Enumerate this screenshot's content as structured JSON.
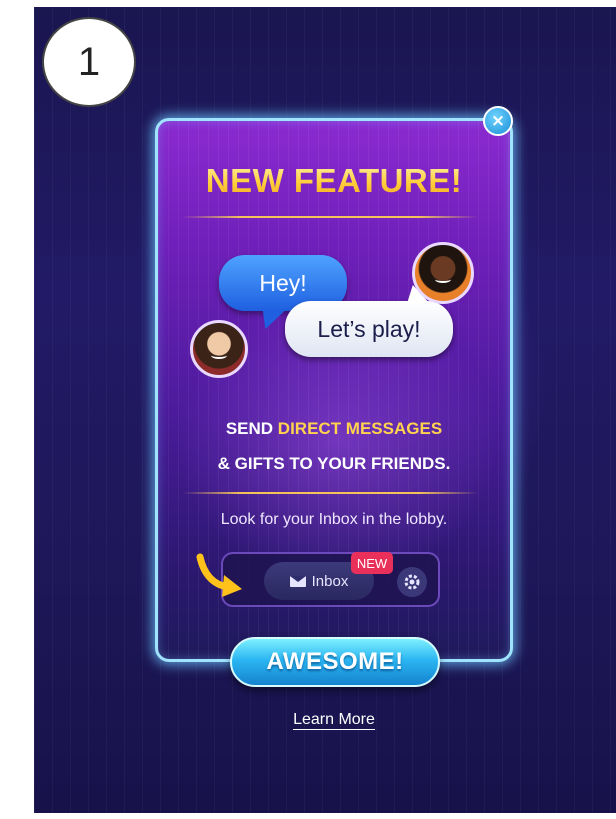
{
  "step_badge": "1",
  "dialog": {
    "title": "NEW FEATURE!",
    "close_label": "×",
    "bubbles": {
      "hey": "Hey!",
      "lets_play": "Let’s play!"
    },
    "headline": {
      "line1_prefix": "SEND ",
      "line1_highlight": "DIRECT MESSAGES",
      "line2": "& GIFTS TO YOUR FRIENDS."
    },
    "lobby_hint": "Look for your Inbox in the lobby.",
    "inbox_preview": {
      "label": "Inbox",
      "badge": "NEW",
      "icons": [
        "mail-icon",
        "gear-icon",
        "arrow-icon"
      ]
    },
    "primary_button": "AWESOME!",
    "secondary_link": "Learn More"
  },
  "colors": {
    "background": "#1e1758",
    "dialog_top": "#8b2ad0",
    "dialog_border": "#9fe3ff",
    "title_gold": "#ffcf3a",
    "highlight_gold": "#ffd34d",
    "button_blue": "#2bb6f2",
    "badge_red": "#e8305a"
  }
}
